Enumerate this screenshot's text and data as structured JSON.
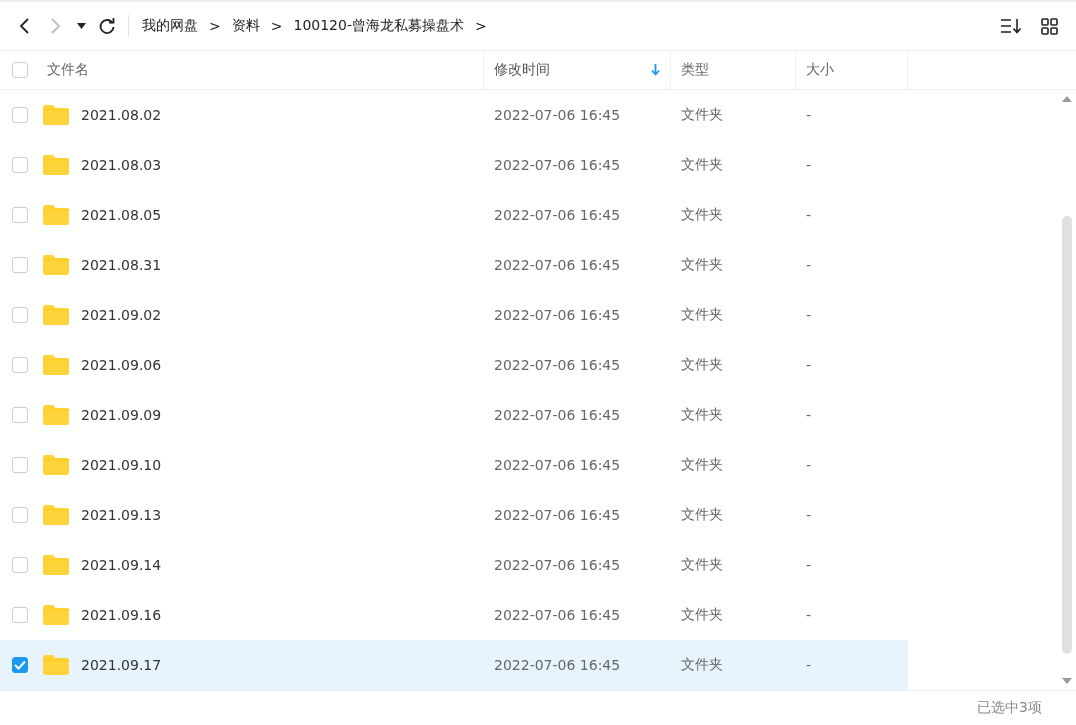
{
  "toolbar": {
    "back_disabled": false,
    "forward_disabled": true,
    "breadcrumb": [
      {
        "label": "我的网盘"
      },
      {
        "label": "资料"
      },
      {
        "label": "100120-曾海龙私募操盘术"
      }
    ],
    "separator": ">"
  },
  "table": {
    "select_all_checked": false,
    "columns": [
      {
        "label": "文件名",
        "sorted": false
      },
      {
        "label": "修改时间",
        "sorted": true
      },
      {
        "label": "类型",
        "sorted": false
      },
      {
        "label": "大小",
        "sorted": false
      }
    ],
    "rows": [
      {
        "name": "2021.08.02",
        "modified": "2022-07-06 16:45",
        "type": "文件夹",
        "size": "-",
        "selected": false
      },
      {
        "name": "2021.08.03",
        "modified": "2022-07-06 16:45",
        "type": "文件夹",
        "size": "-",
        "selected": false
      },
      {
        "name": "2021.08.05",
        "modified": "2022-07-06 16:45",
        "type": "文件夹",
        "size": "-",
        "selected": false
      },
      {
        "name": "2021.08.31",
        "modified": "2022-07-06 16:45",
        "type": "文件夹",
        "size": "-",
        "selected": false
      },
      {
        "name": "2021.09.02",
        "modified": "2022-07-06 16:45",
        "type": "文件夹",
        "size": "-",
        "selected": false
      },
      {
        "name": "2021.09.06",
        "modified": "2022-07-06 16:45",
        "type": "文件夹",
        "size": "-",
        "selected": false
      },
      {
        "name": "2021.09.09",
        "modified": "2022-07-06 16:45",
        "type": "文件夹",
        "size": "-",
        "selected": false
      },
      {
        "name": "2021.09.10",
        "modified": "2022-07-06 16:45",
        "type": "文件夹",
        "size": "-",
        "selected": false
      },
      {
        "name": "2021.09.13",
        "modified": "2022-07-06 16:45",
        "type": "文件夹",
        "size": "-",
        "selected": false
      },
      {
        "name": "2021.09.14",
        "modified": "2022-07-06 16:45",
        "type": "文件夹",
        "size": "-",
        "selected": false
      },
      {
        "name": "2021.09.16",
        "modified": "2022-07-06 16:45",
        "type": "文件夹",
        "size": "-",
        "selected": false
      },
      {
        "name": "2021.09.17",
        "modified": "2022-07-06 16:45",
        "type": "文件夹",
        "size": "-",
        "selected": true
      }
    ]
  },
  "status_bar": {
    "text": "已选中3项"
  }
}
